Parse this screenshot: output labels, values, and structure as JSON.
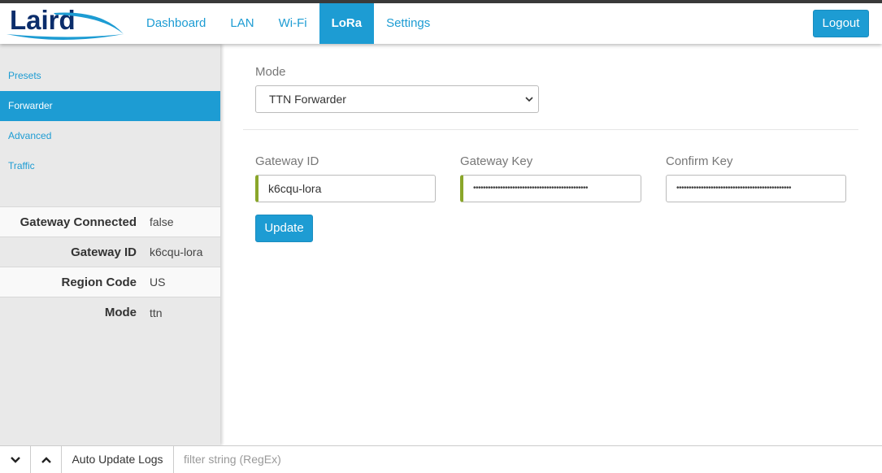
{
  "brand": {
    "logo_text": "Laird"
  },
  "nav": {
    "items": [
      {
        "label": "Dashboard"
      },
      {
        "label": "LAN"
      },
      {
        "label": "Wi-Fi"
      },
      {
        "label": "LoRa",
        "active": true
      },
      {
        "label": "Settings"
      }
    ],
    "logout_label": "Logout"
  },
  "sidebar": {
    "menu": [
      {
        "label": "Presets"
      },
      {
        "label": "Forwarder",
        "active": true
      },
      {
        "label": "Advanced"
      },
      {
        "label": "Traffic"
      }
    ],
    "status": [
      {
        "key": "Gateway Connected",
        "value": "false"
      },
      {
        "key": "Gateway ID",
        "value": "k6cqu-lora"
      },
      {
        "key": "Region Code",
        "value": "US"
      },
      {
        "key": "Mode",
        "value": "ttn"
      }
    ]
  },
  "form": {
    "mode_label": "Mode",
    "mode_value": "TTN Forwarder",
    "gateway_id_label": "Gateway ID",
    "gateway_id_value": "k6cqu-lora",
    "gateway_key_label": "Gateway Key",
    "gateway_key_value": "•••••••••••••••••••••••••••••••••••••••••••••••",
    "confirm_key_label": "Confirm Key",
    "confirm_key_value": "•••••••••••••••••••••••••••••••••••••••••••••••",
    "update_label": "Update"
  },
  "logbar": {
    "auto_update_label": "Auto Update Logs",
    "filter_placeholder": "filter string (RegEx)"
  },
  "colors": {
    "accent": "#1d9cd3",
    "valid": "#8aa62a",
    "logo": "#0b2d6b"
  }
}
